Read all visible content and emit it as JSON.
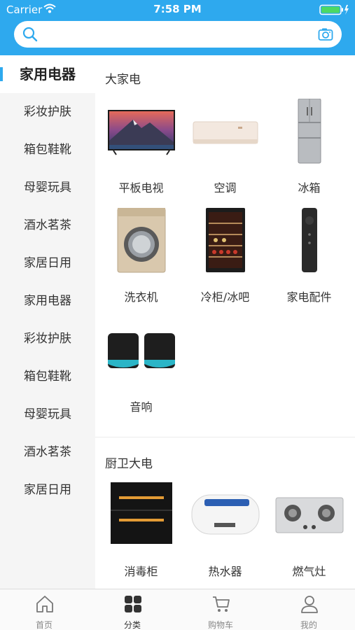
{
  "status_bar": {
    "carrier": "Carrier",
    "time": "7:58 PM"
  },
  "search": {
    "placeholder": ""
  },
  "sidebar": {
    "items": [
      {
        "label": "家用电器",
        "active": true
      },
      {
        "label": "彩妆护肤"
      },
      {
        "label": "箱包鞋靴"
      },
      {
        "label": "母婴玩具"
      },
      {
        "label": "酒水茗茶"
      },
      {
        "label": "家居日用"
      },
      {
        "label": "家用电器"
      },
      {
        "label": "彩妆护肤"
      },
      {
        "label": "箱包鞋靴"
      },
      {
        "label": "母婴玩具"
      },
      {
        "label": "酒水茗茶"
      },
      {
        "label": "家居日用"
      }
    ]
  },
  "sections": [
    {
      "title": "大家电",
      "products": [
        {
          "label": "平板电视",
          "icon": "tv-image"
        },
        {
          "label": "空调",
          "icon": "air-conditioner-image"
        },
        {
          "label": "冰箱",
          "icon": "refrigerator-image"
        },
        {
          "label": "洗衣机",
          "icon": "washing-machine-image"
        },
        {
          "label": "冷柜/冰吧",
          "icon": "wine-cooler-image"
        },
        {
          "label": "家电配件",
          "icon": "remote-control-image"
        },
        {
          "label": "音响",
          "icon": "speakers-image"
        }
      ]
    },
    {
      "title": "厨卫大电",
      "products": [
        {
          "label": "消毒柜",
          "icon": "disinfection-cabinet-image"
        },
        {
          "label": "热水器",
          "icon": "water-heater-image"
        },
        {
          "label": "燃气灶",
          "icon": "gas-stove-image"
        }
      ]
    }
  ],
  "tabbar": {
    "tabs": [
      {
        "label": "首页",
        "icon": "home-icon"
      },
      {
        "label": "分类",
        "icon": "category-icon",
        "active": true
      },
      {
        "label": "购物车",
        "icon": "cart-icon"
      },
      {
        "label": "我的",
        "icon": "user-icon"
      }
    ]
  },
  "colors": {
    "accent": "#2ea9ee",
    "sidebar_bg": "#f5f5f5"
  }
}
